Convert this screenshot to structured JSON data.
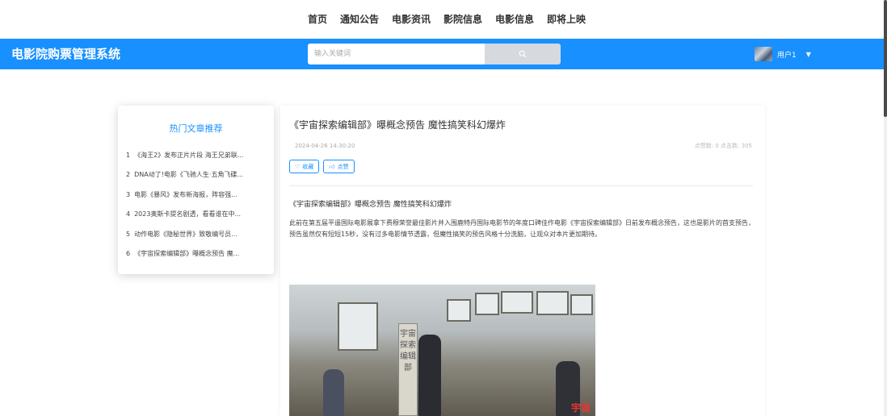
{
  "topnav": {
    "items": [
      "首页",
      "通知公告",
      "电影资讯",
      "影院信息",
      "电影信息",
      "即将上映"
    ]
  },
  "header": {
    "brand": "电影院购票管理系统",
    "search_placeholder": "输入关键词",
    "user_name": "用户1",
    "accent_color": "#1890ff"
  },
  "hot": {
    "title": "热门文章推荐",
    "items": [
      {
        "num": "1",
        "text": "《海王2》发布正片片段 海王兄弟联..."
      },
      {
        "num": "2",
        "text": "DNA动了!电影《飞驰人生·五角飞碟..."
      },
      {
        "num": "3",
        "text": "电影《暴风》发布新海报，阵容强..."
      },
      {
        "num": "4",
        "text": "2023奥斯卡提名剧透，看看谁在中..."
      },
      {
        "num": "5",
        "text": "动作电影《隐秘世界》致敬编号员..."
      },
      {
        "num": "6",
        "text": "《宇宙探索编辑部》曝概念预告 魔..."
      }
    ]
  },
  "article": {
    "title": "《宇宙探索编辑部》曝概念预告 魔性搞笑科幻爆炸",
    "date": "2024-04-26 14:30:20",
    "stats": "点赞数: 0   点击数: 305",
    "collect_label": "收藏",
    "like_label": "点赞",
    "subtitle": "《宇宙探索编辑部》曝概念预告 魔性搞笑科幻爆炸",
    "body": "此前在第五届平遥国际电影展拿下费穆荣誉最佳影片并入围鹿特丹国际电影节的年度口碑佳作电影《宇宙探索编辑部》日前发布概念预告，这也是影片的首支预告，预告虽然仅有短短15秒，没有过多电影情节透露，但魔性搞笑的预告风格十分洗脑，让观众对本片更加期待。",
    "image_sign_text": "宇宙探索编辑部",
    "image_corner_text": "宇宙"
  }
}
